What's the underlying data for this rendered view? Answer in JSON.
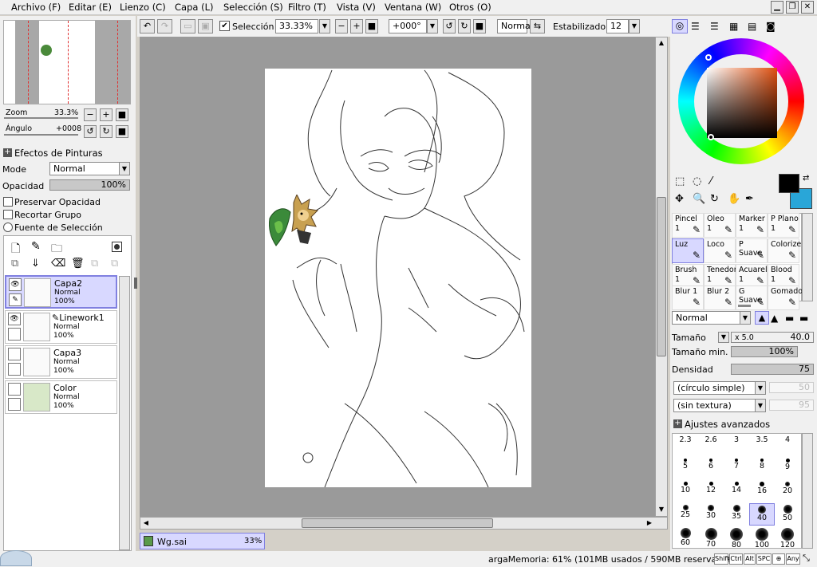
{
  "menu": [
    "Archivo (F)",
    "Editar (E)",
    "Lienzo (C)",
    "Capa (L)",
    "Selección (S)",
    "Filtro (T)",
    "Vista (V)",
    "Ventana (W)",
    "Otros (O)"
  ],
  "toolbar": {
    "selection_label": "Selección",
    "zoom_value": "33.33%",
    "rotation_value": "+000°",
    "mode_value": "Normal",
    "stabilizer_label": "Estabilizador",
    "stabilizer_value": "12"
  },
  "navigator": {
    "zoom_label": "Zoom",
    "zoom_value": "33.3%",
    "angle_label": "Ángulo",
    "angle_value": "+0008"
  },
  "paint_effects": {
    "header": "Efectos de Pinturas",
    "mode_label": "Mode",
    "mode_value": "Normal",
    "opacity_label": "Opacidad",
    "opacity_value": "100%",
    "preserve_opacity": "Preservar Opacidad",
    "clip_group": "Recortar Grupo",
    "selection_source": "Fuente de Selección"
  },
  "layers": [
    {
      "name": "Capa2",
      "mode": "Normal",
      "opacity": "100%",
      "selected": true
    },
    {
      "name": "Linework1",
      "mode": "Normal",
      "opacity": "100%",
      "selected": false
    },
    {
      "name": "Capa3",
      "mode": "Normal",
      "opacity": "100%",
      "selected": false
    },
    {
      "name": "Color",
      "mode": "Normal",
      "opacity": "100%",
      "selected": false
    }
  ],
  "document_tab": {
    "name": "Wg.sai",
    "zoom": "33%"
  },
  "colors": {
    "primary": "#000000",
    "secondary": "#29a6d8",
    "selection_accent": "#8080e0"
  },
  "brushes": [
    {
      "name": "Pincel",
      "size": "1"
    },
    {
      "name": "Oleo",
      "size": "1"
    },
    {
      "name": "Marker",
      "size": "1"
    },
    {
      "name": "P Plano",
      "size": "1"
    },
    {
      "name": "Luz",
      "size": ""
    },
    {
      "name": "Loco",
      "size": ""
    },
    {
      "name": "P Suave",
      "size": ""
    },
    {
      "name": "Colorize",
      "size": ""
    },
    {
      "name": "Brush",
      "size": "1"
    },
    {
      "name": "Tenedor",
      "size": "1"
    },
    {
      "name": "Acuarela",
      "size": "1"
    },
    {
      "name": "Blood",
      "size": "1"
    },
    {
      "name": "Blur 1",
      "size": ""
    },
    {
      "name": "Blur 2",
      "size": ""
    },
    {
      "name": "G Suave",
      "size": ""
    },
    {
      "name": "Gomado",
      "size": ""
    }
  ],
  "brush_settings": {
    "mode_value": "Normal",
    "size_label": "Tamaño",
    "size_mult": "x 5.0",
    "size_value": "40.0",
    "min_size_label": "Tamaño min.",
    "min_size_value": "100%",
    "density_label": "Densidad",
    "density_value": "75",
    "shape_value": "(círculo simple)",
    "shape_amount": "50",
    "texture_value": "(sin textura)",
    "texture_amount": "95",
    "advanced_label": "Ajustes avanzados"
  },
  "brush_sizes": [
    "2.3",
    "2.6",
    "3",
    "3.5",
    "4",
    "5",
    "6",
    "7",
    "8",
    "9",
    "10",
    "12",
    "14",
    "16",
    "20",
    "25",
    "30",
    "35",
    "40",
    "50",
    "60",
    "70",
    "80",
    "100",
    "120"
  ],
  "status": {
    "memory": "argaMemoria: 61% (101MB usados / 590MB reservados)",
    "keys": [
      "Shift",
      "Ctrl",
      "Alt",
      "SPC",
      "⊕",
      "Any"
    ]
  }
}
